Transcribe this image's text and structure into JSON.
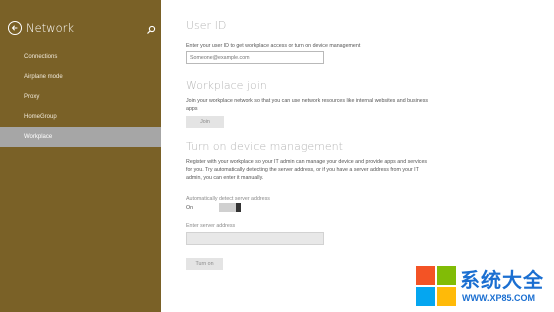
{
  "sidebar": {
    "title": "Network",
    "items": [
      {
        "label": "Connections"
      },
      {
        "label": "Airplane mode"
      },
      {
        "label": "Proxy"
      },
      {
        "label": "HomeGroup"
      },
      {
        "label": "Workplace",
        "active": true
      }
    ],
    "background_color": "#7a6127"
  },
  "main": {
    "user_id": {
      "heading": "User ID",
      "description": "Enter your user ID to get workplace access or turn on device management",
      "placeholder": "Someone@example.com"
    },
    "workplace_join": {
      "heading": "Workplace join",
      "description": "Join your workplace network so that you can use network resources like internal websites and business apps",
      "button": "Join"
    },
    "device_management": {
      "heading": "Turn on device management",
      "description": "Register with your workplace so your IT admin can manage your device and provide apps and services for you. Try automatically detecting the server address, or if you have a server address from your IT admin, you can enter it manually.",
      "auto_detect_label": "Automatically detect server address",
      "toggle_state": "On",
      "server_label": "Enter server address",
      "server_value": "",
      "button": "Turn on"
    }
  },
  "watermark": {
    "name": "系统大全",
    "url": "WWW.XP85.COM",
    "colors": [
      "#f35325",
      "#81bc06",
      "#05a6f0",
      "#ffba08"
    ]
  }
}
